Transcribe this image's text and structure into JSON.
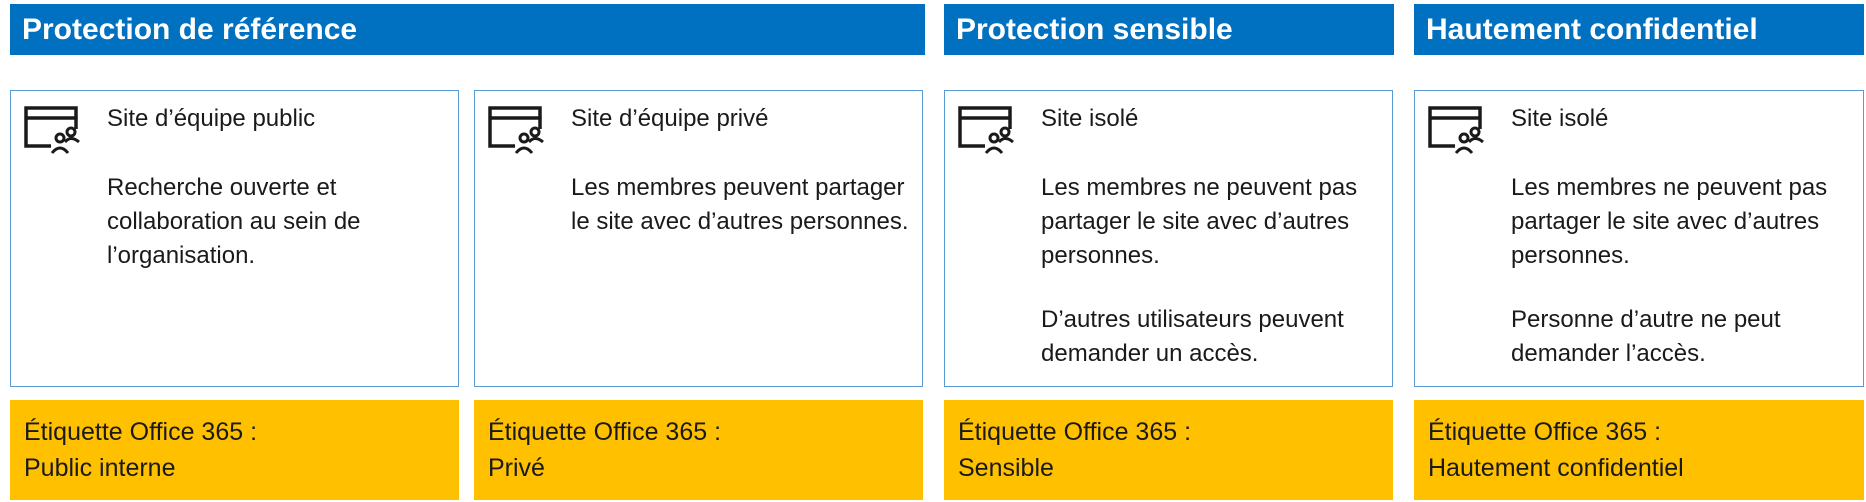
{
  "headers": [
    "Protection de référence",
    "Protection sensible",
    "Hautement confidentiel"
  ],
  "cards": [
    {
      "icon": "team-site-icon",
      "title": "Site d’équipe public",
      "paragraphs": [
        "Recherche ouverte et collaboration au sein de l’organisation."
      ]
    },
    {
      "icon": "team-site-icon",
      "title": "Site d’équipe privé",
      "paragraphs": [
        "Les membres peuvent partager le site avec d’autres personnes."
      ]
    },
    {
      "icon": "team-site-icon",
      "title": "Site isolé",
      "paragraphs": [
        "Les membres ne peuvent pas partager le site avec d’autres personnes.",
        "D’autres utilisateurs peuvent demander un accès."
      ]
    },
    {
      "icon": "team-site-icon",
      "title": "Site isolé",
      "paragraphs": [
        "Les membres ne peuvent pas partager le site avec d’autres personnes.",
        "Personne d’autre ne peut demander l’accès."
      ]
    }
  ],
  "labels": [
    {
      "line1": "Étiquette Office 365 :",
      "line2": "Public interne"
    },
    {
      "line1": "Étiquette Office 365 :",
      "line2": "Privé"
    },
    {
      "line1": "Étiquette Office 365 :",
      "line2": "Sensible"
    },
    {
      "line1": "Étiquette Office 365 :",
      "line2": "Hautement confidentiel"
    }
  ],
  "colors": {
    "header_bg": "#0070c0",
    "card_border": "#5a9bd5",
    "label_bg": "#ffc000"
  }
}
